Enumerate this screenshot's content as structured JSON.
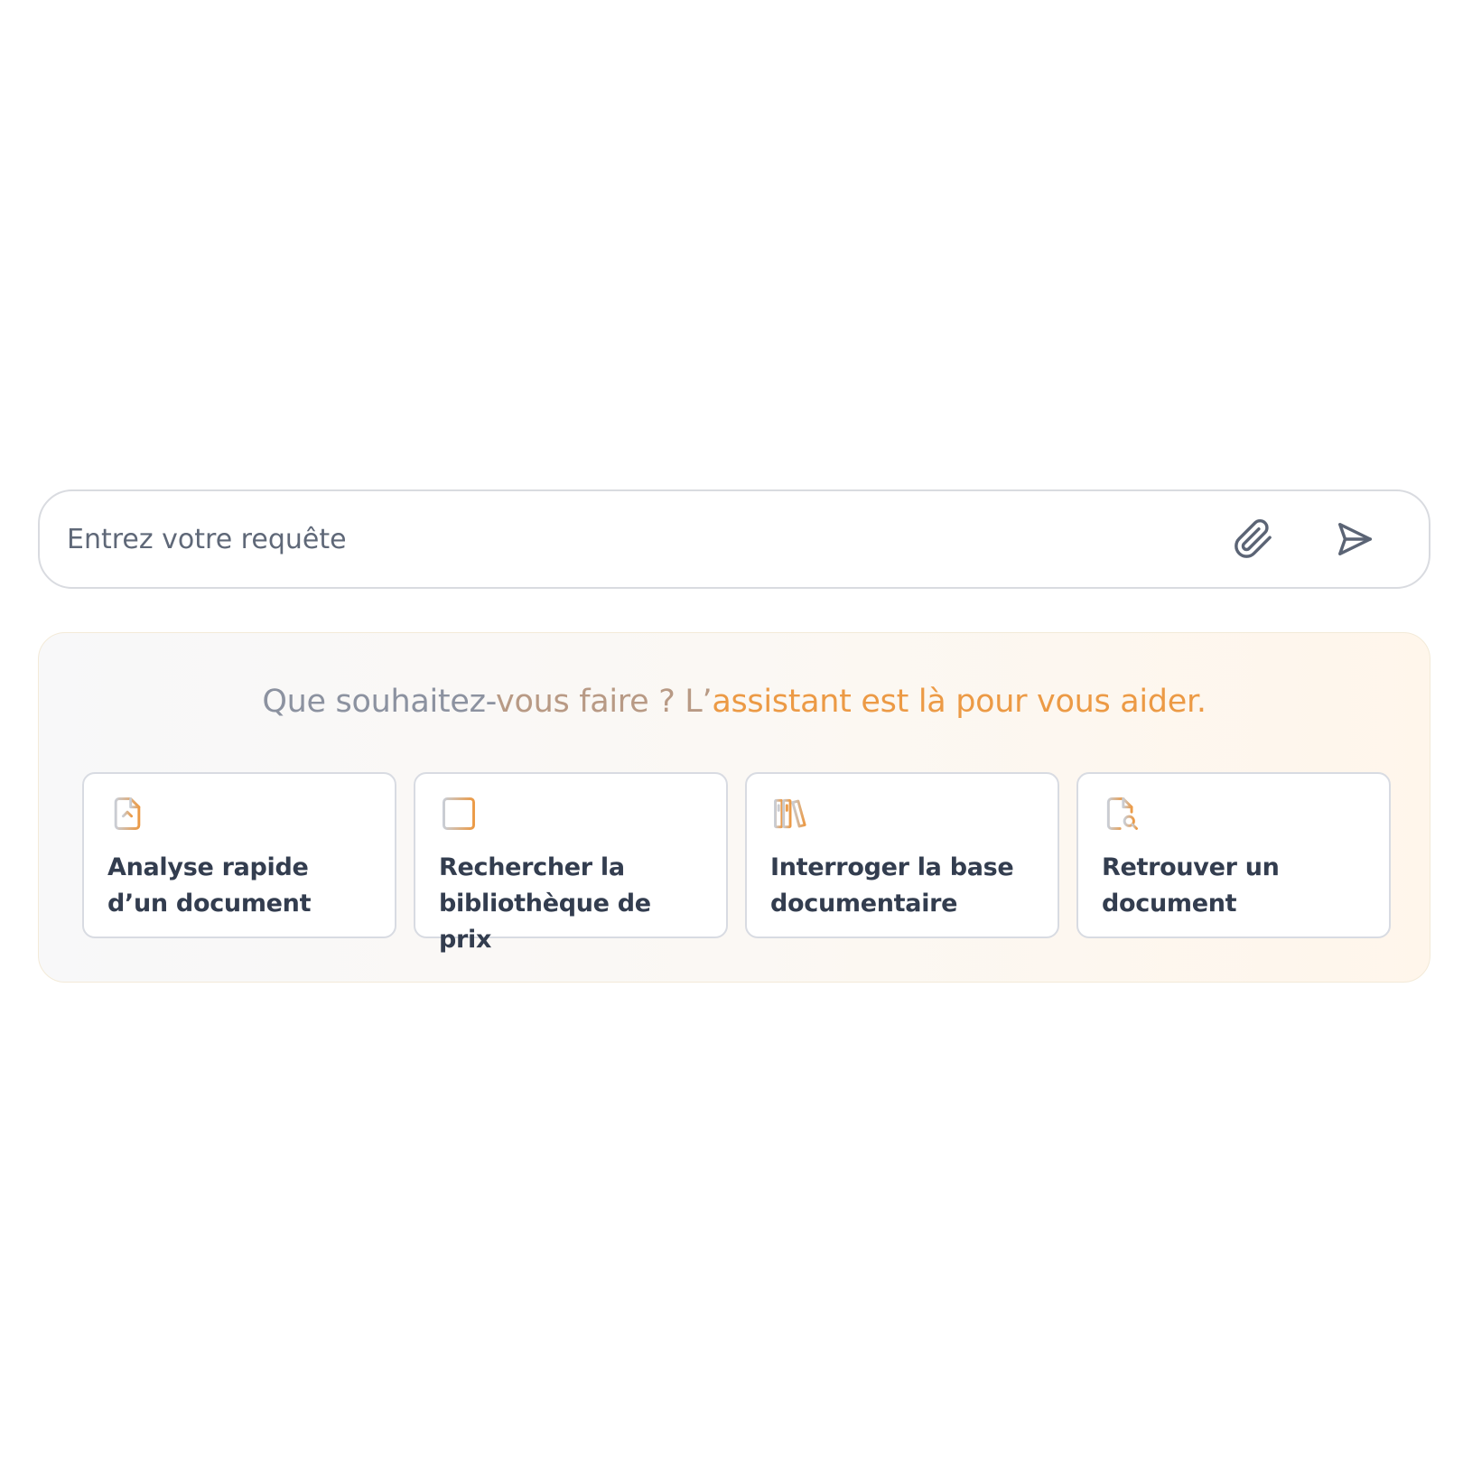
{
  "query": {
    "placeholder": "Entrez votre requête",
    "value": "",
    "attach_icon": "paperclip-icon",
    "send_icon": "send-icon"
  },
  "assistant": {
    "title_part1": "Que souhaitez-",
    "title_part2": "vous faire ? L’",
    "title_part3": "assistant est là pour vous aider.",
    "actions": [
      {
        "icon": "file-upload-icon",
        "label": "Analyse rapide d’un document"
      },
      {
        "icon": "table-icon",
        "label": "Rechercher la bibliothèque de prix"
      },
      {
        "icon": "library-icon",
        "label": "Interroger la base documentaire"
      },
      {
        "icon": "file-search-icon",
        "label": "Retrouver un document"
      }
    ]
  },
  "colors": {
    "accent_orange": "#ec9a45",
    "icon_grey": "#c9cdd4",
    "text_dark": "#333d4f",
    "text_muted": "#8c92a0",
    "border": "#d8dbe2"
  }
}
